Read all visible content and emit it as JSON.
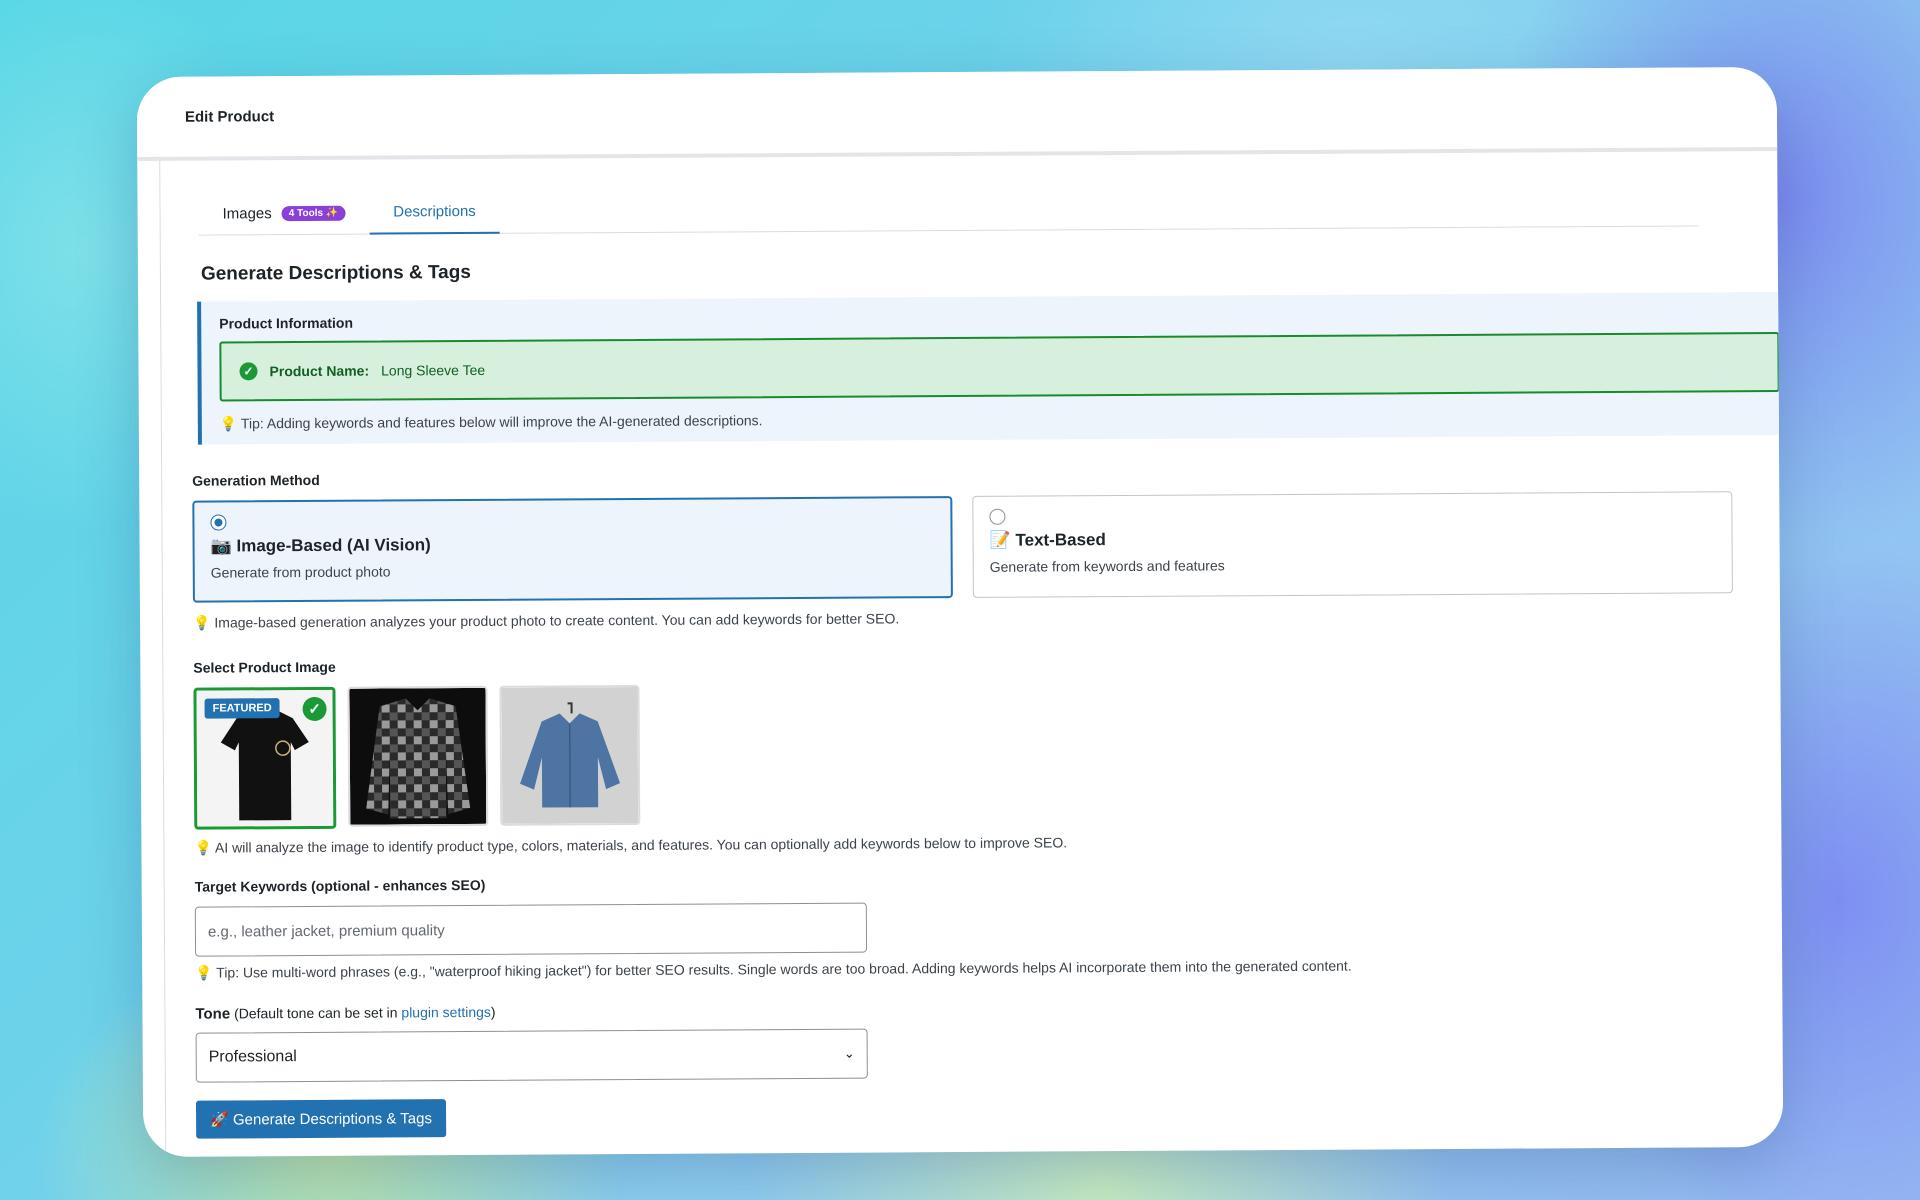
{
  "window": {
    "title": "Edit Product"
  },
  "tabs": [
    {
      "label": "Images",
      "badge": "4 Tools ✨"
    },
    {
      "label": "Descriptions"
    }
  ],
  "heading": "Generate Descriptions & Tags",
  "product_info": {
    "title": "Product Information",
    "name_label": "Product Name:",
    "name_value": "Long Sleeve Tee",
    "tip": "💡 Tip: Adding keywords and features below will improve the AI-generated descriptions."
  },
  "generation_method": {
    "label": "Generation Method",
    "options": [
      {
        "title": "📷 Image-Based (AI Vision)",
        "desc": "Generate from product photo",
        "selected": true
      },
      {
        "title": "📝 Text-Based",
        "desc": "Generate from keywords and features",
        "selected": false
      }
    ],
    "hint": "💡 Image-based generation analyzes your product photo to create content. You can add keywords for better SEO."
  },
  "product_image": {
    "label": "Select Product Image",
    "featured_badge": "FEATURED",
    "images": [
      {
        "icon": "black-tshirt-image",
        "selected": true
      },
      {
        "icon": "plaid-flannel-shirt-image",
        "selected": false
      },
      {
        "icon": "denim-shirt-image",
        "selected": false
      }
    ],
    "hint": "💡 AI will analyze the image to identify product type, colors, materials, and features. You can optionally add keywords below to improve SEO."
  },
  "keywords": {
    "label": "Target Keywords (optional - enhances SEO)",
    "placeholder": "e.g., leather jacket, premium quality",
    "value": "",
    "tip": "💡 Tip: Use multi-word phrases (e.g., \"waterproof hiking jacket\") for better SEO results. Single words are too broad. Adding keywords helps AI incorporate them into the generated content."
  },
  "tone": {
    "label": "Tone",
    "note_prefix": "(Default tone can be set in ",
    "note_link": "plugin settings",
    "note_suffix": ")",
    "selected": "Professional"
  },
  "generate_button": "🚀 Generate Descriptions & Tags",
  "colors": {
    "accent": "#2271b1",
    "success": "#1a9a35",
    "badge_purple": "#8b3fd9"
  }
}
